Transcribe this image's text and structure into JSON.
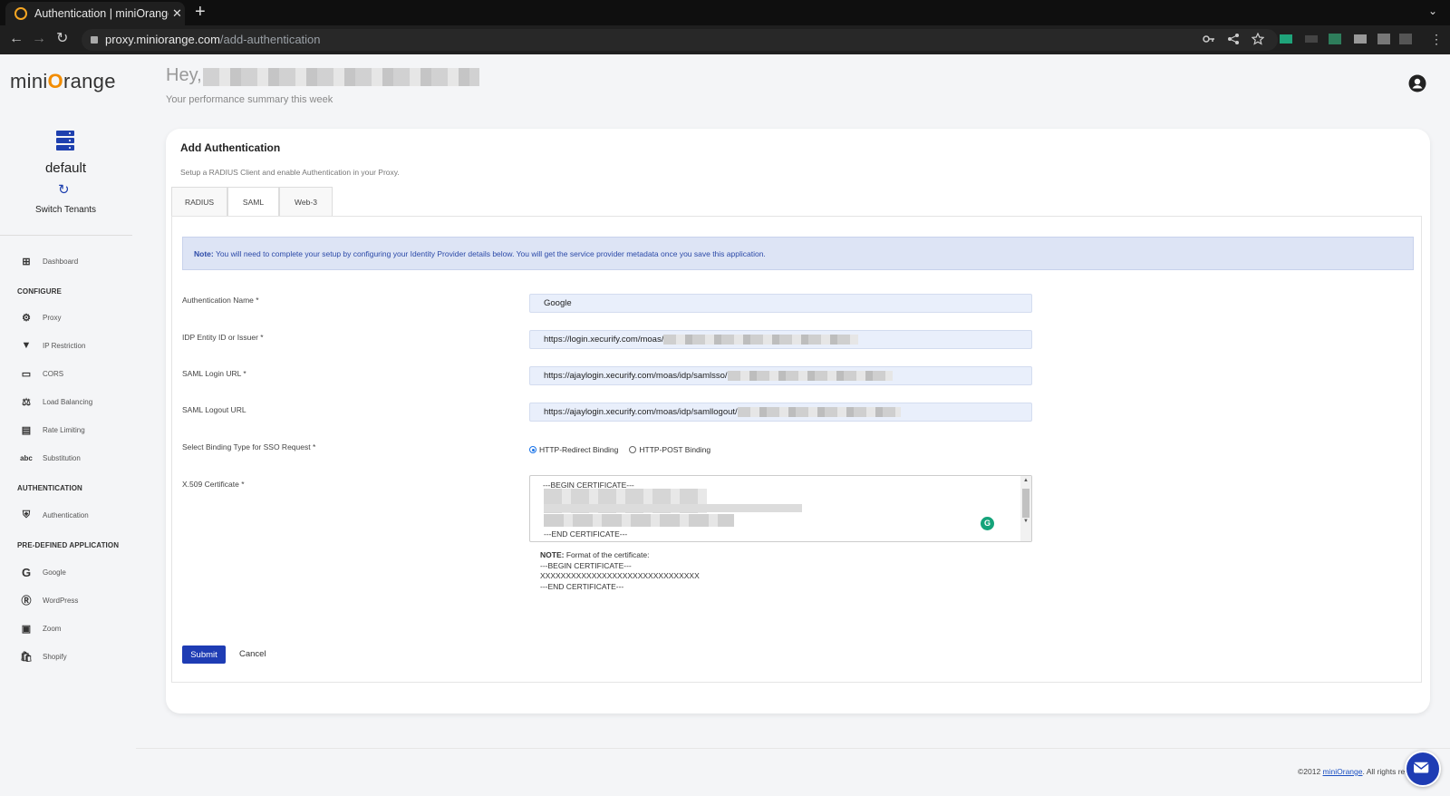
{
  "browser": {
    "tab_title": "Authentication | miniOrange",
    "tab_close": "✕",
    "new_tab": "+",
    "url_host": "proxy.miniorange.com",
    "url_path": "/add-authentication"
  },
  "sidebar": {
    "logo_prefix": "mini",
    "logo_o": "O",
    "logo_suffix": "range",
    "tenant_name": "default",
    "switch_label": "Switch Tenants",
    "dashboard": "Dashboard",
    "section_configure": "CONFIGURE",
    "configure_items": [
      "Proxy",
      "IP Restriction",
      "CORS",
      "Load Balancing",
      "Rate Limiting",
      "Substitution"
    ],
    "section_authentication": "AUTHENTICATION",
    "authentication_item": "Authentication",
    "section_predefined": "PRE-DEFINED APPLICATION",
    "predefined_items": [
      "Google",
      "WordPress",
      "Zoom",
      "Shopify"
    ]
  },
  "header": {
    "greeting": "Hey,",
    "subtitle": "Your performance summary this week"
  },
  "card": {
    "title": "Add Authentication",
    "subtitle": "Setup a RADIUS Client and enable Authentication in your Proxy.",
    "tabs": [
      "RADIUS",
      "SAML",
      "Web-3"
    ],
    "active_tab": "SAML",
    "note_label": "Note:",
    "note_text": " You will need to complete your setup by configuring your Identity Provider details below. You will get the service provider metadata once you save this application."
  },
  "form": {
    "auth_name_label": "Authentication Name *",
    "auth_name_value": "Google",
    "idp_entity_label": "IDP Entity ID or Issuer *",
    "idp_entity_value": "https://login.xecurify.com/moas/",
    "saml_login_label": "SAML Login URL *",
    "saml_login_value": "https://ajaylogin.xecurify.com/moas/idp/samlsso/",
    "saml_logout_label": "SAML Logout URL",
    "saml_logout_value": "https://ajaylogin.xecurify.com/moas/idp/samllogout/",
    "binding_label": "Select Binding Type for SSO Request *",
    "binding_options": [
      "HTTP-Redirect Binding",
      "HTTP-POST Binding"
    ],
    "binding_selected": "HTTP-Redirect Binding",
    "cert_label": "X.509 Certificate *",
    "cert_begin": "---BEGIN CERTIFICATE---",
    "cert_end": "---END CERTIFICATE---",
    "format_note_label": "NOTE:",
    "format_note_text": " Format of the certificate:",
    "format_begin": "---BEGIN CERTIFICATE---",
    "format_body": "XXXXXXXXXXXXXXXXXXXXXXXXXXXXXXX",
    "format_end": "---END CERTIFICATE---",
    "submit_label": "Submit",
    "cancel_label": "Cancel"
  },
  "footer": {
    "copyright_prefix": "©2012 ",
    "copyright_link": "miniOrange",
    "copyright_suffix": ". All rights res"
  },
  "colors": {
    "primary": "#1e3cb4",
    "note_bg": "#dde4f5",
    "input_bg": "#e9effb",
    "brand_orange": "#f28c00"
  }
}
